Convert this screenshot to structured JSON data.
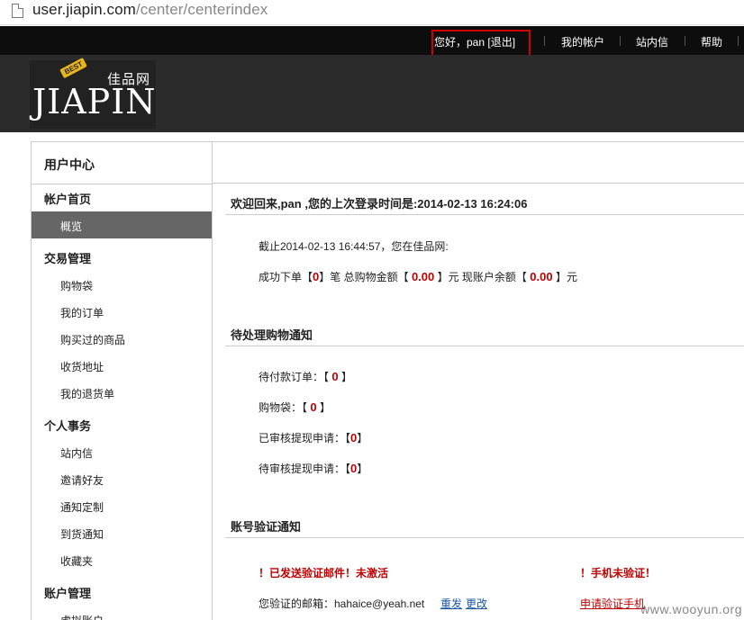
{
  "browser": {
    "url_host": "user.jiapin.com",
    "url_path": "/center/centerindex"
  },
  "topbar": {
    "greeting": "您好，pan [退出]",
    "my_account": "我的帐户",
    "messages": "站内信",
    "help": "帮助"
  },
  "logo": {
    "cn": "佳品网",
    "en": "JIAPIN",
    "badge": "BEST"
  },
  "sidebar": {
    "title": "用户中心",
    "groups": [
      {
        "label": "帐户首页",
        "items": [
          "概览"
        ]
      },
      {
        "label": "交易管理",
        "items": [
          "购物袋",
          "我的订单",
          "购买过的商品",
          "收货地址",
          "我的退货单"
        ]
      },
      {
        "label": "个人事务",
        "items": [
          "站内信",
          "邀请好友",
          "通知定制",
          "到货通知",
          "收藏夹"
        ]
      },
      {
        "label": "账户管理",
        "items": [
          "虚拟账户"
        ]
      }
    ]
  },
  "welcome": {
    "text": "欢迎回来,pan ,您的上次登录时间是:2014-02-13 16:24:06"
  },
  "summary": {
    "as_of": "截止2014-02-13 16:44:57，您在佳品网:",
    "orders_prefix": "成功下单【",
    "orders_count": "0",
    "orders_suffix": "】笔 总购物金额【",
    "total_amount": "0.00",
    "total_suffix": "】元 现账户余额【",
    "balance": "0.00",
    "balance_suffix": "】元"
  },
  "pending": {
    "title": "待处理购物通知",
    "rows": [
      {
        "label": "待付款订单：【",
        "value": "0",
        "end": "】"
      },
      {
        "label": "购物袋：【",
        "value": "0",
        "end": "】"
      },
      {
        "label": "已审核提现申请：【",
        "value": "0",
        "end": "】"
      },
      {
        "label": "待审核提现申请：【",
        "value": "0",
        "end": "】"
      }
    ]
  },
  "verify": {
    "title": "账号验证通知",
    "email_warning": "！已发送验证邮件！未激活",
    "phone_warning": "！手机未验证！",
    "email_label": "您验证的邮箱：hahaice@yeah.net",
    "resend": "重发",
    "change": "更改",
    "apply_phone": "申请验证手机"
  },
  "watermark": "www.wooyun.org"
}
